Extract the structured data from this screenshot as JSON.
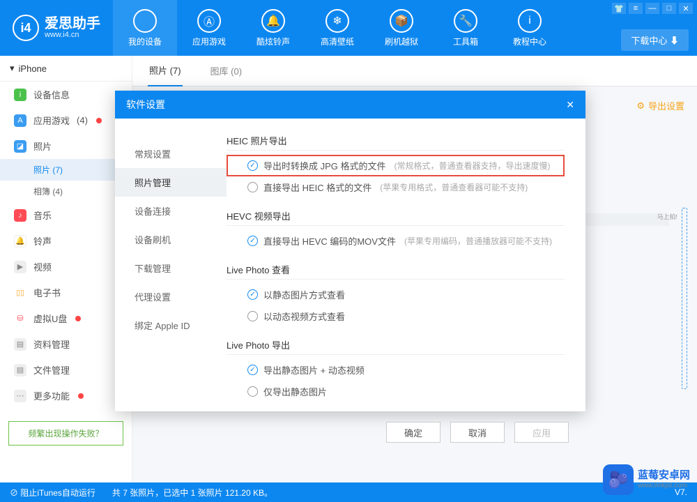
{
  "header": {
    "logo_text": "爱思助手",
    "logo_sub": "www.i4.cn",
    "nav": [
      {
        "label": "我的设备",
        "icon": ""
      },
      {
        "label": "应用游戏",
        "icon": "Ⓐ"
      },
      {
        "label": "酷炫铃声",
        "icon": "🔔"
      },
      {
        "label": "高清壁纸",
        "icon": "❄"
      },
      {
        "label": "刷机越狱",
        "icon": "📦"
      },
      {
        "label": "工具箱",
        "icon": "🔧"
      },
      {
        "label": "教程中心",
        "icon": "i"
      }
    ],
    "download_center": "下载中心 ⬇"
  },
  "win_buttons": [
    "👕",
    "≡",
    "—",
    "□",
    "✕"
  ],
  "sidebar": {
    "device": "iPhone",
    "items": [
      {
        "label": "设备信息",
        "color": "#4cc24c",
        "glyph": "i"
      },
      {
        "label": "应用游戏",
        "count": "(4)",
        "dot": true,
        "color": "#3a9cf1",
        "glyph": "A"
      },
      {
        "label": "照片",
        "color": "#3a9cf1",
        "glyph": "◪"
      },
      {
        "label": "音乐",
        "color": "#ff4b55",
        "glyph": "♪"
      },
      {
        "label": "铃声",
        "color": "#4aa0ec",
        "glyph": "🔔"
      },
      {
        "label": "视频",
        "color": "#888",
        "glyph": "▶"
      },
      {
        "label": "电子书",
        "color": "#f5a623",
        "glyph": "▯▯"
      },
      {
        "label": "虚拟U盘",
        "dot": true,
        "color": "#ff4b55",
        "glyph": "⛁"
      },
      {
        "label": "资料管理",
        "color": "#888",
        "glyph": "▤"
      },
      {
        "label": "文件管理",
        "color": "#888",
        "glyph": "▤"
      },
      {
        "label": "更多功能",
        "dot": true,
        "color": "#888",
        "glyph": "⋯"
      }
    ],
    "photo_sub": [
      {
        "label": "照片",
        "count": "(7)"
      },
      {
        "label": "相簿",
        "count": "(4)"
      }
    ],
    "help": "频繁出现操作失败？"
  },
  "tabs": [
    {
      "label": "照片",
      "count": "(7)"
    },
    {
      "label": "图库",
      "count": "(0)"
    }
  ],
  "export_cfg": "导出设置",
  "grey_row": "med",
  "strip_label": "马上拍!",
  "modal": {
    "title": "软件设置",
    "close": "✕",
    "side": [
      "常规设置",
      "照片管理",
      "设备连接",
      "设备刷机",
      "下载管理",
      "代理设置",
      "绑定 Apple ID"
    ],
    "sections": [
      {
        "title": "HEIC 照片导出",
        "opts": [
          {
            "label": "导出时转换成 JPG 格式的文件",
            "hint": "(常规格式，普通查看器支持，导出速度慢)",
            "on": true,
            "hl": true
          },
          {
            "label": "直接导出 HEIC 格式的文件",
            "hint": "(苹果专用格式，普通查看器可能不支持)",
            "on": false
          }
        ]
      },
      {
        "title": "HEVC 视频导出",
        "opts": [
          {
            "label": "直接导出 HEVC 编码的MOV文件",
            "hint": "(苹果专用编码，普通播放器可能不支持)",
            "on": true
          }
        ]
      },
      {
        "title": "Live Photo 查看",
        "opts": [
          {
            "label": "以静态图片方式查看",
            "on": true
          },
          {
            "label": "以动态视频方式查看",
            "on": false
          }
        ]
      },
      {
        "title": "Live Photo 导出",
        "opts": [
          {
            "label": "导出静态图片 + 动态视频",
            "on": true
          },
          {
            "label": "仅导出静态图片",
            "on": false
          }
        ]
      }
    ],
    "buttons": {
      "ok": "确定",
      "cancel": "取消",
      "apply": "应用"
    }
  },
  "status": {
    "itunes": "阻止iTunes自动运行",
    "info": "共 7 张照片，已选中 1 张照片 121.20 KB。",
    "ver": "V7."
  },
  "watermark": {
    "text": "蓝莓安卓网",
    "sub": "www.lmkjst.com",
    "glyph": "🫐"
  }
}
